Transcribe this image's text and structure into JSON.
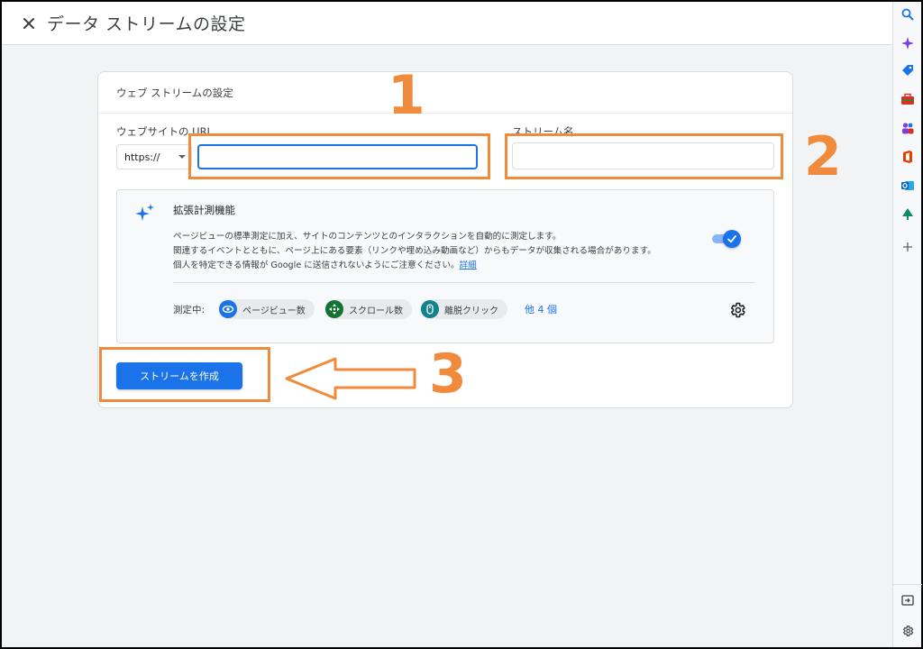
{
  "header": {
    "title": "データ ストリームの設定"
  },
  "card": {
    "title": "ウェブ ストリームの設定",
    "url_label": "ウェブサイトの URL",
    "protocol_value": "https://",
    "url_value": "",
    "stream_name_label": "ストリーム名",
    "stream_name_value": ""
  },
  "enhanced": {
    "title": "拡張計測機能",
    "description_line1": "ページビューの標準測定に加え、サイトのコンテンツとのインタラクションを自動的に測定します。",
    "description_line2": "関連するイベントとともに、ページ上にある要素（リンクや埋め込み動画など）からもデータが収集される場合があります。",
    "description_line3": "個人を特定できる情報が Google に送信されないようにご注意ください。",
    "details_link": "詳細",
    "toggle_on": true,
    "measuring_label": "測定中:",
    "chips": [
      {
        "label": "ページビュー数",
        "icon": "eye-icon",
        "color": "#1a73e8"
      },
      {
        "label": "スクロール数",
        "icon": "crosshair-icon",
        "color": "#137333"
      },
      {
        "label": "離脱クリック",
        "icon": "mouse-icon",
        "color": "#12828c"
      }
    ],
    "more_link": "他 4 個"
  },
  "create_button": "ストリームを作成",
  "annotations": [
    "1",
    "2",
    "3"
  ],
  "colors": {
    "accent": "#1a73e8",
    "highlight": "#f08a3c"
  },
  "right_rail": {
    "icons": [
      "search-icon",
      "copilot-icon",
      "tag-icon",
      "briefcase-icon",
      "people-icon",
      "office-icon",
      "outlook-icon",
      "tree-icon",
      "add-icon",
      "sidebar-toggle-icon",
      "settings-icon"
    ]
  }
}
